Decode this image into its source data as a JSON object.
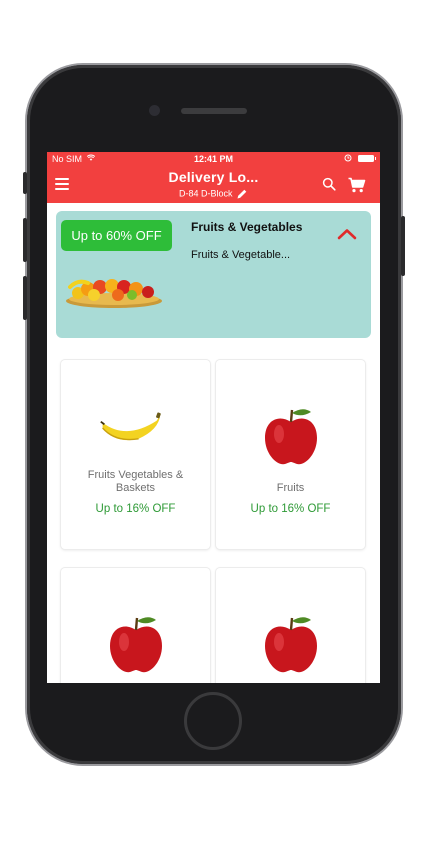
{
  "status_bar": {
    "carrier": "No SIM",
    "time": "12:41 PM"
  },
  "app_bar": {
    "title": "Delivery Lo...",
    "subtitle": "D-84 D-Block"
  },
  "banner": {
    "badge": "Up to 60% OFF",
    "title": "Fruits & Vegetables",
    "subtitle": "Fruits & Vegetable..."
  },
  "categories": [
    {
      "label": "Fruits Vegetables & Baskets",
      "offer": "Up to 16% OFF",
      "image": "banana"
    },
    {
      "label": "Fruits",
      "offer": "Up to 16% OFF",
      "image": "apple"
    },
    {
      "label": "",
      "offer": "",
      "image": "apple"
    },
    {
      "label": "",
      "offer": "",
      "image": "apple"
    }
  ],
  "colors": {
    "accent": "#f2403f",
    "banner_bg": "#a9dbd6",
    "badge_bg": "#2ebd39",
    "offer_text": "#2e9a36"
  },
  "icons": [
    "menu-icon",
    "edit-icon",
    "search-icon",
    "cart-icon",
    "chevron-up-icon",
    "wifi-icon",
    "battery-icon",
    "alarm-icon"
  ]
}
